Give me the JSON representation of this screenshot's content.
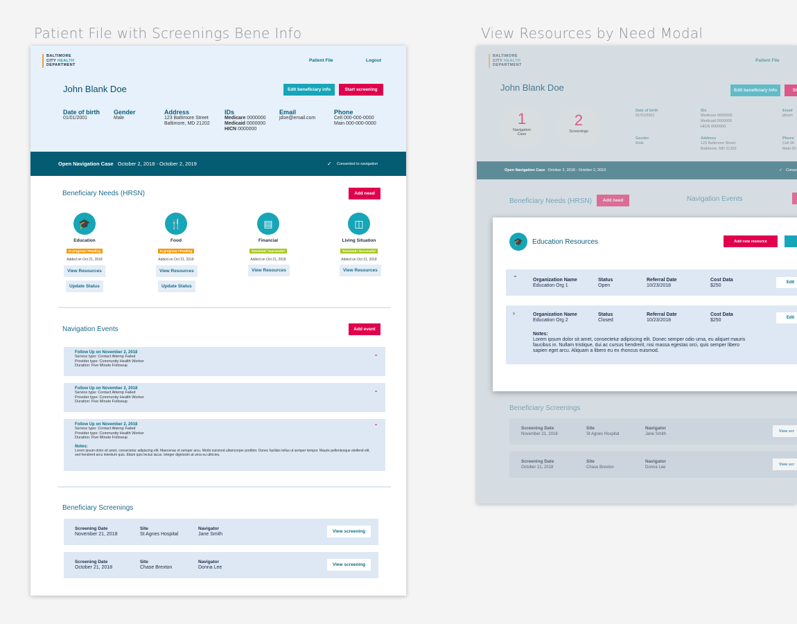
{
  "captions": {
    "left": "Patient File with Screenings Bene Info",
    "right": "View Resources by Need Modal"
  },
  "logo": {
    "line1": "BALTIMORE",
    "line2a": "CITY ",
    "line2b": "HEALTH",
    "line3": "DEPARTMENT"
  },
  "nav": {
    "patient_file": "Patient File",
    "logout": "Logout"
  },
  "patient": {
    "name": "John Blank Doe",
    "edit_btn": "Edit beneficiary info",
    "start_btn": "Start screening",
    "dob_label": "Date of birth",
    "dob": "01/01/2001",
    "gender_label": "Gender",
    "gender": "Male",
    "address_label": "Address",
    "address1": "123 Baltimore Street",
    "address2": "Baltimore, MD 21202",
    "ids_label": "IDs",
    "medicare_label": "Medicare",
    "medicare": " 0000000",
    "medicaid_label": "Medicaid",
    "medicaid": " 0000000",
    "hicn_label": "HICN",
    "hicn": " 0000000",
    "email_label": "Email",
    "email": "jdoe@email.com",
    "phone_label": "Phone",
    "cell": "Cell 000-000-0000",
    "main": "Main 000-000-0000"
  },
  "case": {
    "label": "Open Navigation Case",
    "dates": "October 2, 2018 - October 2, 2019",
    "consent": "Consented to navigation"
  },
  "needs": {
    "title": "Beneficiary Needs (HRSN)",
    "add_btn": "Add need",
    "items": [
      {
        "name": "Education",
        "status": "In progress / Pending",
        "added": "Added on Oct 21, 2018",
        "icon": "graduation-cap-icon"
      },
      {
        "name": "Food",
        "status": "In progress / Pending",
        "added": "Added on Oct 21, 2018",
        "icon": "fork-knife-icon"
      },
      {
        "name": "Financial",
        "status": "Resolved / Successful",
        "added": "Added on Oct 21, 2018",
        "icon": "credit-card-icon"
      },
      {
        "name": "Living Situation",
        "status": "Resolved / Successful",
        "added": "Added on Oct 21, 2018",
        "icon": "bed-icon"
      }
    ],
    "view_resources": "View Resources",
    "update_status": "Update Status"
  },
  "events": {
    "title": "Navigation Events",
    "add_btn": "Add event",
    "items": [
      {
        "title": "Follow Up on November 2, 2018",
        "service": "Service type: Contact Attemp Failed",
        "provider": "Provider type: Community Health Worker",
        "duration": "Duration: Five Minute Followup"
      },
      {
        "title": "Follow Up on November 2, 2018",
        "service": "Service type: Contact Attemp Failed",
        "provider": "Provider type: Community Health Worker",
        "duration": "Duration: Five Minute Followup"
      },
      {
        "title": "Follow Up on November 2, 2018",
        "service": "Service type: Contact Attemp Failed",
        "provider": "Provider type: Community Health Worker",
        "duration": "Duration: Five Minute Followup",
        "notes_label": "Notes:",
        "notes": "Lorem ipsum dolor sit amet, consectetur adipiscing elit. Maecenas et semper arcu. Morbi euismod ullamcorper porttitor. Donec facilisis tellus ut semper tempor. Mauris pellentesque eleifend elit, sed hendrerit arcu interdum quis. Etiam quis lectus lacus. Integer dignissim at urna eu ultricies."
      }
    ]
  },
  "screenings": {
    "title": "Beneficiary Screenings",
    "date_label": "Screening Date",
    "site_label": "Site",
    "nav_label": "Navigator",
    "view_btn": "View screening",
    "rows": [
      {
        "date": "November 21, 2018",
        "site": "St Agnes Hospital",
        "navigator": "Jane Smith"
      },
      {
        "date": "October 21, 2018",
        "site": "Chase Brexton",
        "navigator": "Donna Lee"
      }
    ]
  },
  "right": {
    "patient_file": "Patient File",
    "name": "John Blank Doe",
    "edit_btn": "Edit beneficiary info",
    "start_btn": "St",
    "nav_case_count": "1",
    "nav_case_label": "Navigation Case",
    "screenings_count": "2",
    "screenings_label": "Screenings",
    "dob_label": "Date of birth",
    "dob": "01/01/2001",
    "ids_label": "IDs",
    "medicare": "Medicare 0000000",
    "medicaid": "Medicaid 0000000",
    "hicn": "HICN 0000000",
    "email_label": "Email",
    "email": "jdoem",
    "gender_label": "Gender",
    "gender": "Male",
    "address_label": "Address",
    "address1": "123 Baltimore Street",
    "address2": "Baltimore, MD 21202",
    "phone_label": "Phone",
    "cell": "Cell 00",
    "main": "Main 00",
    "case_label": "Open Navigation Case",
    "case_dates": "October 2, 2018 - October 2, 2019",
    "consent": "Conse",
    "needs_title": "Beneficiary Needs (HRSN)",
    "add_need": "Add need",
    "events_title": "Navigation Events",
    "screenings_title": "Beneficiary Screenings",
    "screen_rows": [
      {
        "date": "November 21, 2018",
        "site": "St Agnes Hospital",
        "navigator": "Jane Smith",
        "view": "View scr"
      },
      {
        "date": "October 21, 2018",
        "site": "Chase Brexton",
        "navigator": "Donna Lee",
        "view": "View scr"
      }
    ]
  },
  "modal": {
    "title": "Education Resources",
    "add_btn": "Add new resource",
    "org_label": "Organization Name",
    "status_label": "Status",
    "ref_label": "Referral Date",
    "cost_label": "Cost Data",
    "edit": "Edit",
    "rows": [
      {
        "org": "Education Org 1",
        "status": "Open",
        "date": "10/23/2018",
        "cost": "$250"
      },
      {
        "org": "Education Org 2",
        "status": "Closed",
        "date": "10/23/2018",
        "cost": "$250",
        "notes_label": "Notes:",
        "notes": "Lorem ipsum dolor sit amet, consectetur adipiscing elit. Donec semper odio urna, eu aliquet mauris faucibus in. Nullam tristique, dui ac cursus hendrerit, nisi massa egestas orci, quis semper libero sapien eget arcu. Aliquam a libero eu ex rhoncus euismod."
      }
    ]
  },
  "colors": {
    "teal": "#17a5b8",
    "pink": "#e0004d",
    "navy": "#045c73",
    "pending": "#f39c12",
    "resolved": "#a6c820"
  }
}
